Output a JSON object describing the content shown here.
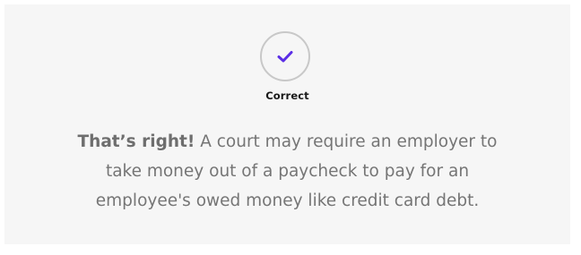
{
  "result": {
    "status_label": "Correct",
    "icon": "checkmark-icon",
    "accent_color": "#5b2ee6"
  },
  "feedback": {
    "lead": "That’s right!",
    "body": "A court may require an employer to take money out of a paycheck to pay for an employee's owed money like credit card debt."
  }
}
